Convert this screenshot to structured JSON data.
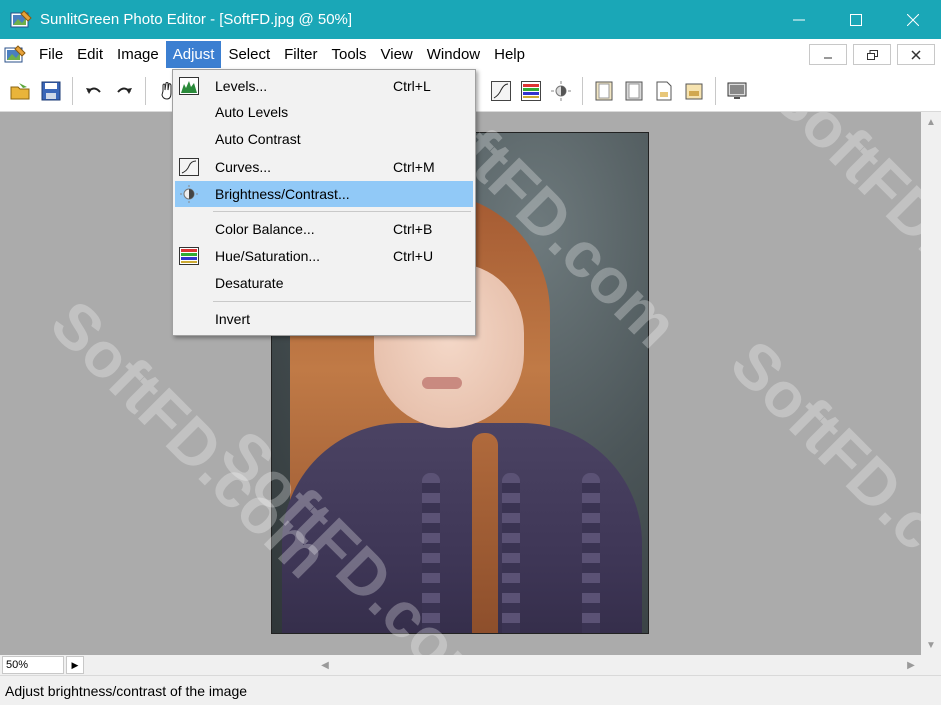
{
  "window": {
    "title": "SunlitGreen Photo Editor - [SoftFD.jpg @ 50%]",
    "controls": {
      "minimize": "—",
      "maximize": "☐",
      "close": "✕"
    }
  },
  "menu": {
    "items": [
      {
        "label": "File"
      },
      {
        "label": "Edit"
      },
      {
        "label": "Image"
      },
      {
        "label": "Adjust"
      },
      {
        "label": "Select"
      },
      {
        "label": "Filter"
      },
      {
        "label": "Tools"
      },
      {
        "label": "View"
      },
      {
        "label": "Window"
      },
      {
        "label": "Help"
      }
    ],
    "active": "Adjust",
    "mdi_controls": {
      "minimize": "–",
      "restore": "🗗",
      "close": "✕"
    }
  },
  "adjust_menu": {
    "items": [
      {
        "label": "Levels...",
        "shortcut": "Ctrl+L",
        "icon": "levels-icon"
      },
      {
        "label": "Auto Levels",
        "shortcut": "",
        "icon": ""
      },
      {
        "label": "Auto Contrast",
        "shortcut": "",
        "icon": ""
      },
      {
        "label": "Curves...",
        "shortcut": "Ctrl+M",
        "icon": "curves-icon"
      },
      {
        "label": "Brightness/Contrast...",
        "shortcut": "",
        "icon": "brightness-icon",
        "highlighted": true
      },
      {
        "label": "Color Balance...",
        "shortcut": "Ctrl+B",
        "icon": ""
      },
      {
        "label": "Hue/Saturation...",
        "shortcut": "Ctrl+U",
        "icon": "hue-saturation-icon"
      },
      {
        "label": "Desaturate",
        "shortcut": "",
        "icon": ""
      },
      {
        "label": "Invert",
        "shortcut": "",
        "icon": ""
      }
    ]
  },
  "canvas": {
    "watermark": "SoftFD.com",
    "background": "#ababab"
  },
  "zoom": {
    "value": "50%"
  },
  "status": {
    "text": "Adjust brightness/contrast of the image"
  },
  "colors": {
    "titlebar": "#1aa7b7",
    "menu_active": "#3c7fd1",
    "menu_highlight": "#91c9f7"
  }
}
